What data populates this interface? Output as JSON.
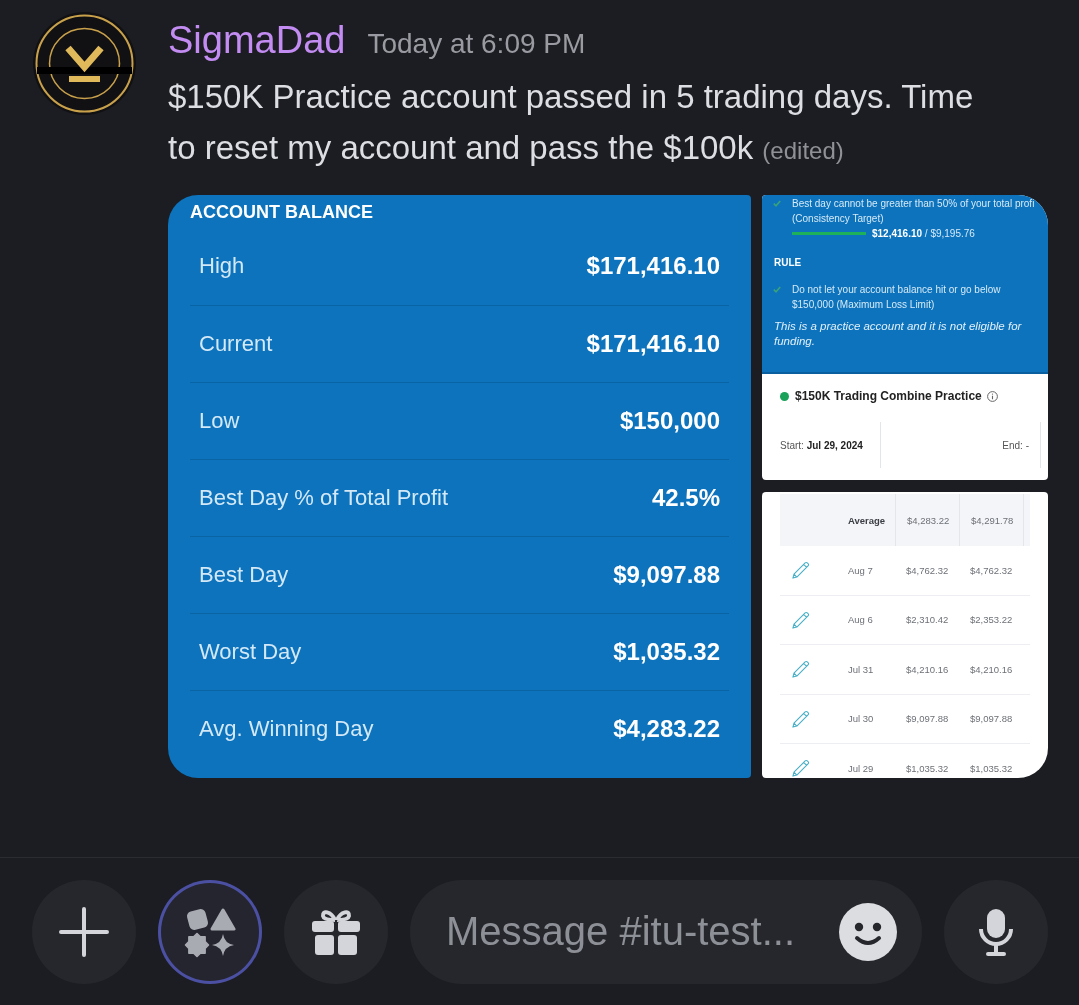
{
  "message": {
    "author": "SigmaDad",
    "timestamp": "Today at 6:09 PM",
    "text": "$150K Practice account passed in 5 trading days. Time to reset my account and pass the $100k",
    "edited": "(edited)"
  },
  "attachments": [
    {
      "kind": "balance",
      "title": "ACCOUNT BALANCE",
      "rows": [
        {
          "label": "High",
          "value": "$171,416.10"
        },
        {
          "label": "Current",
          "value": "$171,416.10"
        },
        {
          "label": "Low",
          "value": "$150,000"
        },
        {
          "label": "Best Day % of Total Profit",
          "value": "42.5%"
        },
        {
          "label": "Best Day",
          "value": "$9,097.88"
        },
        {
          "label": "Worst Day",
          "value": "$1,035.32"
        },
        {
          "label": "Avg. Winning Day",
          "value": "$4,283.22"
        }
      ]
    },
    {
      "kind": "rules",
      "goal": {
        "text": "Best day cannot be greater than 50% of your total profi",
        "note": "(Consistency Target)",
        "checked": true,
        "progress": {
          "level": 1,
          "text": "**$12,416.10** / $9,195.76"
        }
      },
      "rule_heading": "RULE",
      "rule": {
        "text": "Do not let your account balance hit or go below $150,000 (Maximum Loss Limit)",
        "checked": true
      },
      "disclaimer": "This is a practice account and it is not eligible for funding.",
      "account": {
        "name": "$150K Trading Combine Practice",
        "color": "#1aa15a",
        "start": "Start: **Jul 29, 2024**",
        "end": "End: -"
      }
    },
    {
      "kind": "daily_table",
      "header": {
        "label": "Average",
        "values": [
          "$4,283.22",
          "$4,291.78"
        ]
      },
      "rows": [
        {
          "date": "Aug 7",
          "values": [
            "$4,762.32",
            "$4,762.32"
          ]
        },
        {
          "date": "Aug 6",
          "values": [
            "$2,310.42",
            "$2,353.22"
          ]
        },
        {
          "date": "Jul 31",
          "values": [
            "$4,210.16",
            "$4,210.16"
          ]
        },
        {
          "date": "Jul 30",
          "values": [
            "$9,097.88",
            "$9,097.88"
          ]
        },
        {
          "date": "Jul 29",
          "values": [
            "$1,035.32",
            "$1,035.32"
          ]
        }
      ]
    }
  ],
  "composer": {
    "leading_buttons": [
      {
        "kind": "add",
        "highlighted": false
      },
      {
        "kind": "apps",
        "highlighted": true
      },
      {
        "kind": "gift",
        "highlighted": false
      }
    ],
    "placeholder": "Message #itu-test...",
    "trailing_buttons": [
      {
        "kind": "microphone",
        "highlighted": false
      }
    ]
  }
}
